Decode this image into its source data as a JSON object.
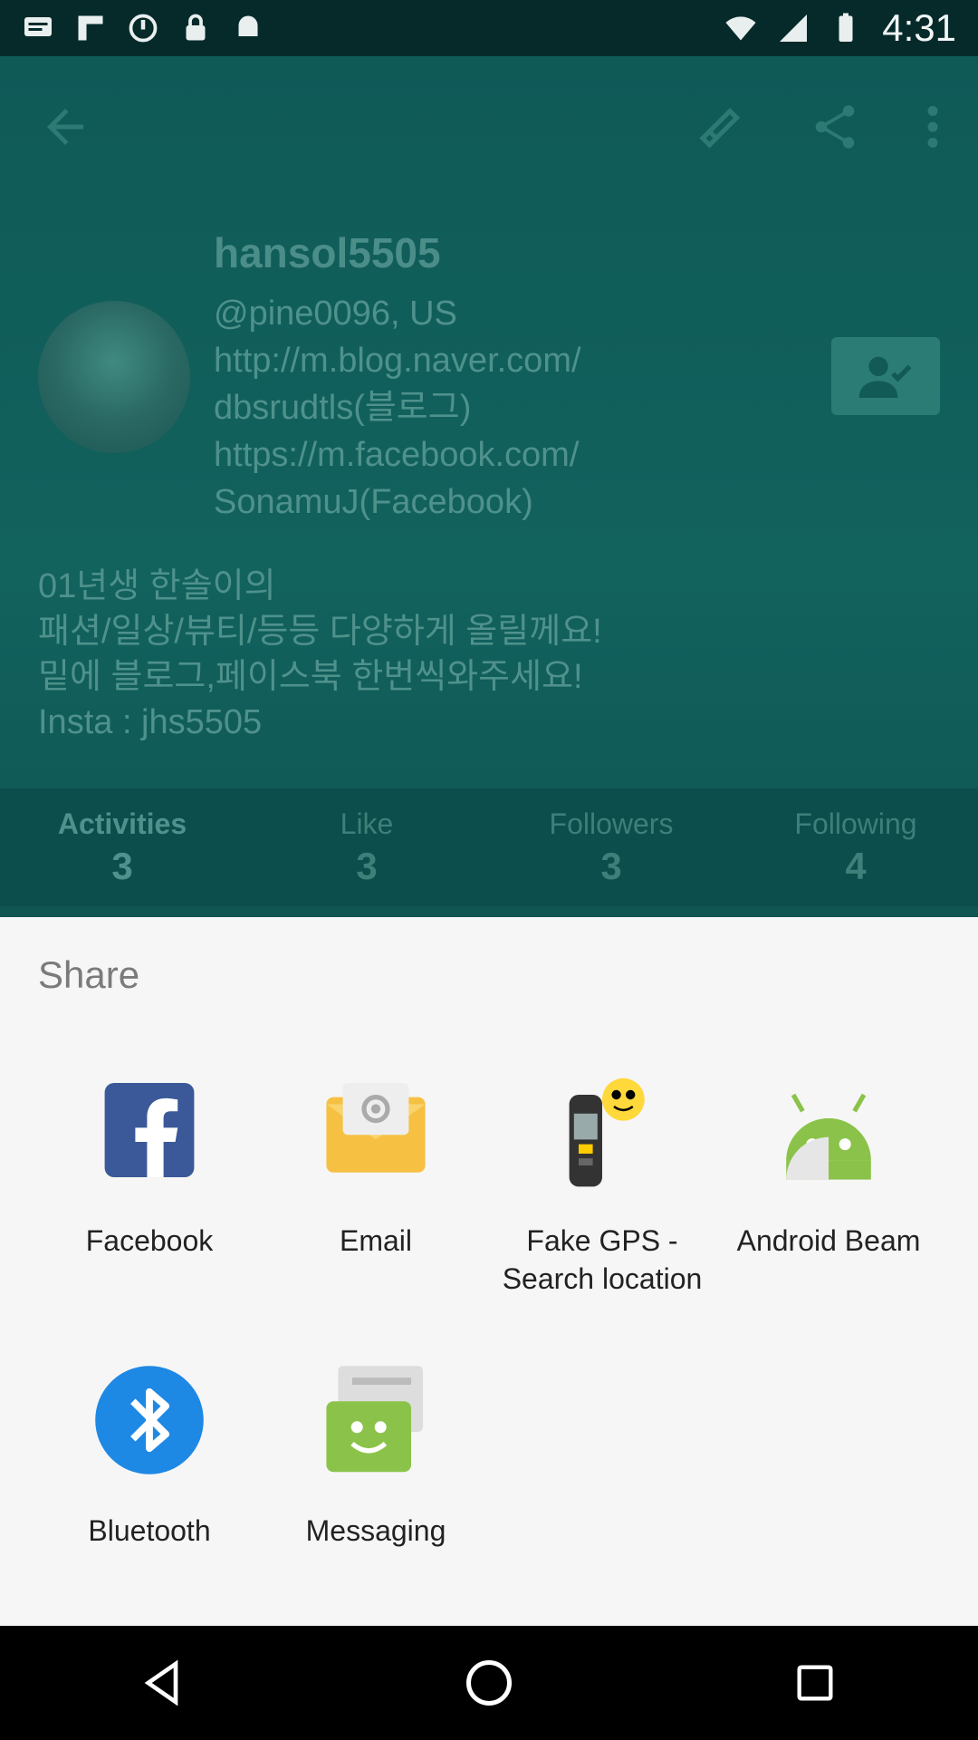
{
  "status_bar": {
    "time": "4:31",
    "left_icons": [
      "message-icon",
      "flipboard-icon",
      "sync-icon",
      "lock-icon",
      "android-icon"
    ],
    "right_icons": [
      "wifi-icon",
      "signal-icon",
      "battery-icon"
    ]
  },
  "background_app": {
    "toolbar_icons": [
      "back-arrow-icon",
      "link-icon",
      "share-icon",
      "more-vert-icon"
    ],
    "profile": {
      "name": "hansol5505",
      "info_lines": "@pine0096, US\nhttp://m.blog.naver.com/\ndbsrudtls(블로그)\nhttps://m.facebook.com/\nSonamuJ(Facebook)",
      "bio": "01년생 한솔이의\n패션/일상/뷰티/등등 다양하게 올릴께요!\n밑에 블로그,페이스북 한번씩와주세요!\nInsta : jhs5505"
    },
    "stats": [
      {
        "label": "Activities",
        "value": "3"
      },
      {
        "label": "Like",
        "value": "3"
      },
      {
        "label": "Followers",
        "value": "3"
      },
      {
        "label": "Following",
        "value": "4"
      }
    ]
  },
  "share": {
    "title": "Share",
    "apps": [
      {
        "label": "Facebook",
        "icon": "facebook-icon"
      },
      {
        "label": "Email",
        "icon": "email-icon"
      },
      {
        "label": "Fake GPS -\nSearch location",
        "icon": "fake-gps-icon"
      },
      {
        "label": "Android Beam",
        "icon": "android-beam-icon"
      },
      {
        "label": "Bluetooth",
        "icon": "bluetooth-icon"
      },
      {
        "label": "Messaging",
        "icon": "messaging-icon"
      }
    ]
  },
  "nav_bar": {
    "buttons": [
      "back-icon",
      "home-icon",
      "recents-icon"
    ]
  },
  "colors": {
    "facebook": "#3b5998",
    "email": "#f6c142",
    "android": "#8bc34a",
    "bluetooth": "#1e88e5",
    "messaging": "#8bc34a"
  }
}
